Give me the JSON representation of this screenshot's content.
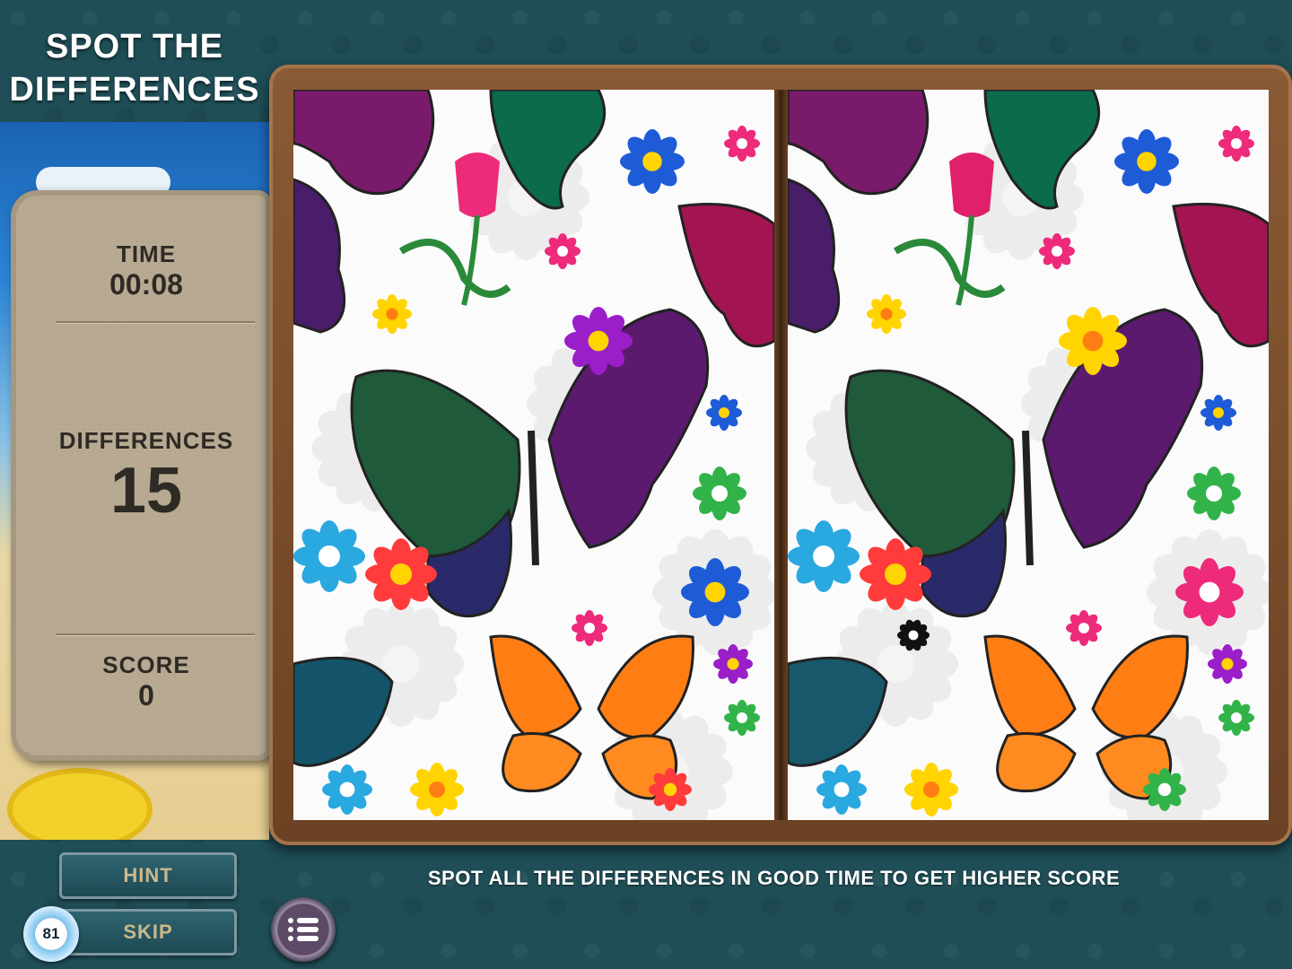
{
  "header": {
    "title_line1": "SPOT THE",
    "title_line2": "DIFFERENCES"
  },
  "stats": {
    "time_label": "TIME",
    "time_value": "00:08",
    "differences_label": "DIFFERENCES",
    "differences_value": "15",
    "score_label": "SCORE",
    "score_value": "0"
  },
  "buttons": {
    "hint": "HINT",
    "skip": "SKIP",
    "skip_count": "81"
  },
  "instruction": "SPOT ALL THE DIFFERENCES IN GOOD TIME TO GET HIGHER SCORE",
  "colors": {
    "frame": "#7a4c2a",
    "background": "#1f4e57",
    "panel": "#b8aa92",
    "button_text": "#cbb989"
  }
}
